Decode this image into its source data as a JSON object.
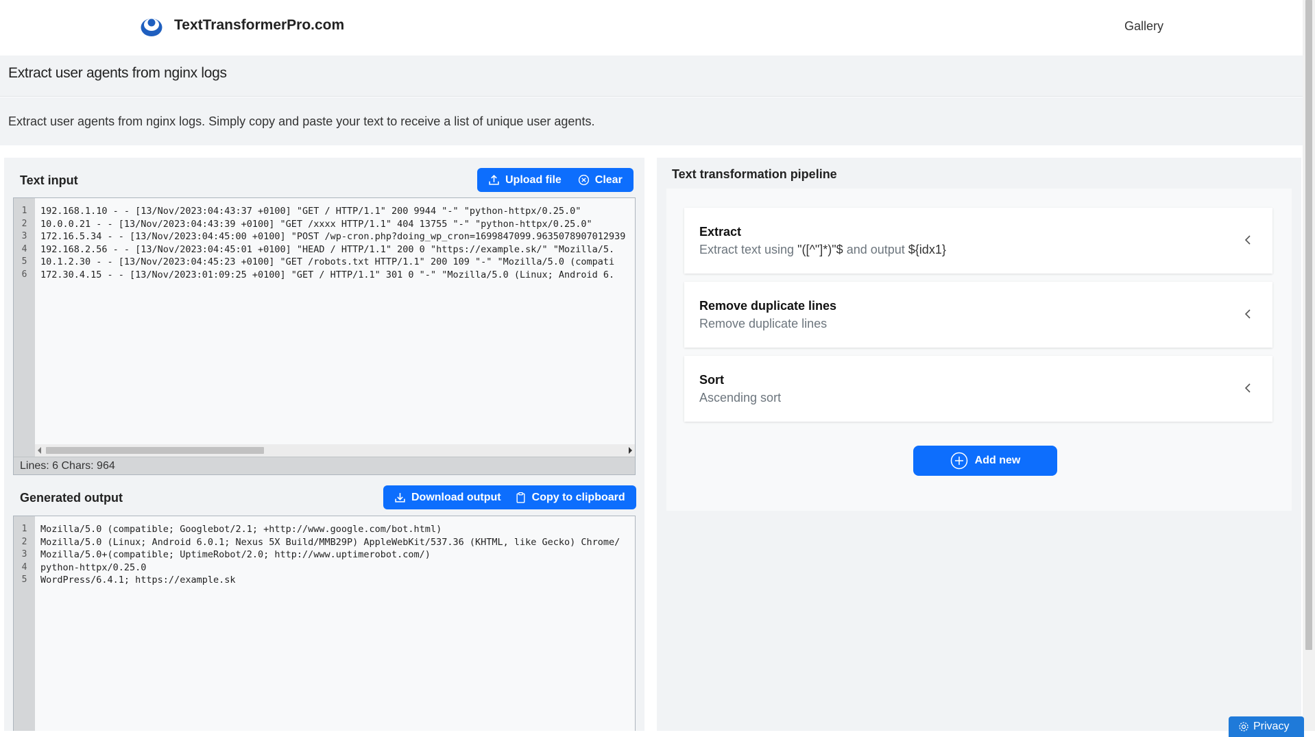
{
  "header": {
    "brand": "TextTransformerPro.com",
    "nav_gallery": "Gallery"
  },
  "page": {
    "title": "Extract user agents from nginx logs",
    "description": "Extract user agents from nginx logs. Simply copy and paste your text to receive a list of unique user agents."
  },
  "input": {
    "title": "Text input",
    "upload_label": "Upload file",
    "clear_label": "Clear",
    "lines": [
      {
        "n": "1",
        "text": "192.168.1.10 - - [13/Nov/2023:04:43:37 +0100] \"GET / HTTP/1.1\" 200 9944 \"-\" \"python-httpx/0.25.0\""
      },
      {
        "n": "2",
        "text": "10.0.0.21 - - [13/Nov/2023:04:43:39 +0100] \"GET /xxxx HTTP/1.1\" 404 13755 \"-\" \"python-httpx/0.25.0\""
      },
      {
        "n": "3",
        "text": "172.16.5.34 - - [13/Nov/2023:04:45:00 +0100] \"POST /wp-cron.php?doing_wp_cron=1699847099.9635078907012939"
      },
      {
        "n": "4",
        "text": "192.168.2.56 - - [13/Nov/2023:04:45:01 +0100] \"HEAD / HTTP/1.1\" 200 0 \"https://example.sk/\" \"Mozilla/5."
      },
      {
        "n": "5",
        "text": "10.1.2.30 - - [13/Nov/2023:04:45:23 +0100] \"GET /robots.txt HTTP/1.1\" 200 109 \"-\" \"Mozilla/5.0 (compati"
      },
      {
        "n": "6",
        "text": "172.30.4.15 - - [13/Nov/2023:01:09:25 +0100] \"GET / HTTP/1.1\" 301 0 \"-\" \"Mozilla/5.0 (Linux; Android 6."
      }
    ],
    "stats": "Lines: 6  Chars: 964"
  },
  "output": {
    "title": "Generated output",
    "download_label": "Download output",
    "copy_label": "Copy to clipboard",
    "lines": [
      {
        "n": "1",
        "text": "Mozilla/5.0 (compatible; Googlebot/2.1; +http://www.google.com/bot.html)"
      },
      {
        "n": "2",
        "text": "Mozilla/5.0 (Linux; Android 6.0.1; Nexus 5X Build/MMB29P) AppleWebKit/537.36 (KHTML, like Gecko) Chrome/"
      },
      {
        "n": "3",
        "text": "Mozilla/5.0+(compatible; UptimeRobot/2.0; http://www.uptimerobot.com/)"
      },
      {
        "n": "4",
        "text": "python-httpx/0.25.0"
      },
      {
        "n": "5",
        "text": "WordPress/6.4.1; https://example.sk"
      }
    ]
  },
  "pipeline": {
    "title": "Text transformation pipeline",
    "steps": [
      {
        "title": "Extract",
        "desc_prefix": "Extract text using ",
        "pattern": "\"([^\"]*)\"$",
        "desc_mid": " and output ",
        "output": "${idx1}"
      },
      {
        "title": "Remove duplicate lines",
        "desc": "Remove duplicate lines"
      },
      {
        "title": "Sort",
        "desc": "Ascending sort"
      }
    ],
    "add_label": "Add new"
  },
  "privacy_label": "Privacy",
  "colors": {
    "accent": "#0d6efd",
    "panel_bg": "#f1f3f5",
    "muted_text": "#6c757d"
  }
}
